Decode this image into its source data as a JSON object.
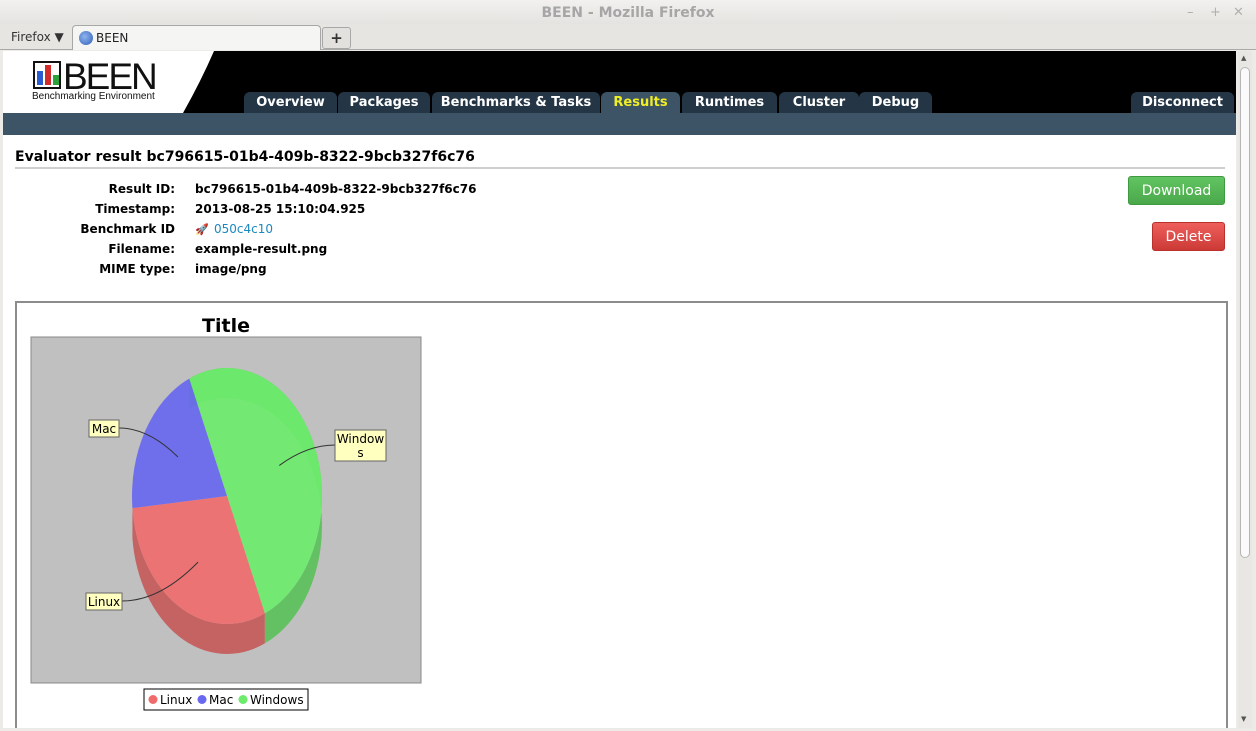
{
  "window": {
    "title": "BEEN - Mozilla Firefox",
    "firefox_menu": "Firefox ▼",
    "tab_title": "BEEN",
    "new_tab": "+"
  },
  "app": {
    "logo_text": "BEEN",
    "logo_subtitle": "Benchmarking Environment",
    "nav": [
      {
        "label": "Overview"
      },
      {
        "label": "Packages"
      },
      {
        "label": "Benchmarks & Tasks"
      },
      {
        "label": "Results",
        "active": true
      },
      {
        "label": "Runtimes"
      },
      {
        "label": "Cluster"
      },
      {
        "label": "Debug"
      }
    ],
    "disconnect": "Disconnect"
  },
  "result": {
    "heading": "Evaluator result bc796615-01b4-409b-8322-9bcb327f6c76",
    "fields": [
      {
        "label": "Result ID:",
        "value": "bc796615-01b4-409b-8322-9bcb327f6c76"
      },
      {
        "label": "Timestamp:",
        "value": "2013-08-25 15:10:04.925"
      },
      {
        "label": "Benchmark ID",
        "value": "050c4c10",
        "link": true
      },
      {
        "label": "Filename:",
        "value": "example-result.png"
      },
      {
        "label": "MIME type:",
        "value": "image/png"
      }
    ],
    "download_label": "Download",
    "delete_label": "Delete"
  },
  "colors": {
    "linux": "#f06c6c",
    "mac": "#6868f0",
    "windows": "#6ceb6c",
    "active_tab_text": "#f0ee25",
    "download": "#5cb85c",
    "delete": "#d9534f"
  },
  "chart_data": {
    "type": "pie",
    "title": "Title",
    "categories": [
      "Linux",
      "Mac",
      "Windows"
    ],
    "values": [
      30,
      20,
      50
    ],
    "legend": [
      "Linux",
      "Mac",
      "Windows"
    ],
    "legend_position": "bottom",
    "style": "3d"
  }
}
